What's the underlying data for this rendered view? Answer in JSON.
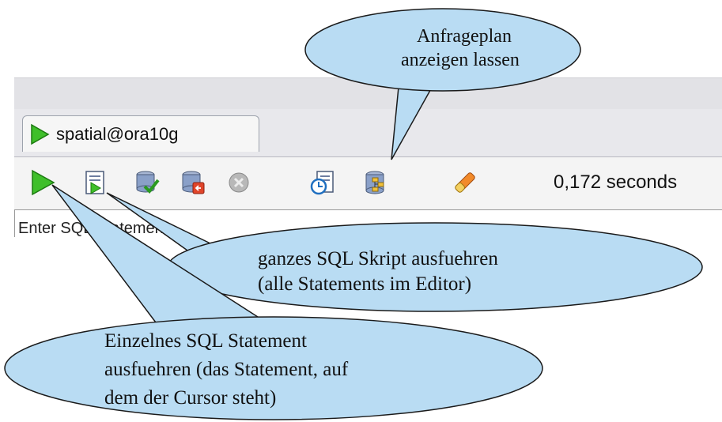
{
  "tab": {
    "label": "spatial@ora10g"
  },
  "toolbar": {
    "elapsed": "0,172 seconds",
    "buttons": [
      {
        "icon": "run-statement-icon"
      },
      {
        "icon": "run-script-icon"
      },
      {
        "icon": "commit-icon"
      },
      {
        "icon": "rollback-icon"
      },
      {
        "icon": "cancel-icon"
      },
      {
        "icon": "sql-history-icon"
      },
      {
        "icon": "explain-plan-icon"
      },
      {
        "icon": "clear-icon"
      }
    ]
  },
  "editor": {
    "label": "Enter SQL Statement:"
  },
  "callouts": {
    "plan": {
      "line1": "Anfrageplan",
      "line2": "anzeigen lassen"
    },
    "script": {
      "line1": "ganzes SQL Skript ausfuehren",
      "line2": "(alle Statements im Editor)"
    },
    "statement": {
      "line1": "Einzelnes SQL Statement",
      "line2": "ausfuehren (das Statement, auf",
      "line3": "dem der Cursor steht)"
    }
  },
  "colors": {
    "callout_fill": "#b9dcf3",
    "callout_stroke": "#1a1a1a",
    "run_green": "#3fbf2a"
  }
}
